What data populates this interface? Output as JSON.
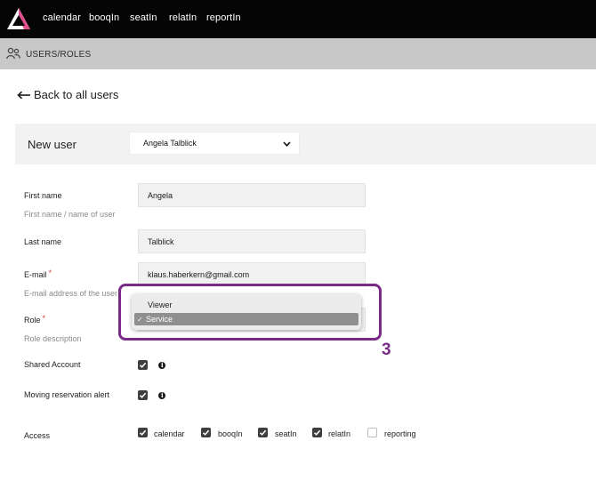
{
  "nav": {
    "items": [
      {
        "label": "calendar"
      },
      {
        "label": "booqIn"
      },
      {
        "label": "seatIn"
      },
      {
        "label": "relatIn"
      },
      {
        "label": "reportIn"
      }
    ]
  },
  "section": {
    "title": "USERS/ROLES"
  },
  "back": {
    "label": "Back to all users"
  },
  "header": {
    "title": "New user",
    "selected_user": "Angela Talblick"
  },
  "form": {
    "first_name": {
      "label": "First name",
      "value": "Angela",
      "help": "First name / name of user"
    },
    "last_name": {
      "label": "Last name",
      "value": "Talblick"
    },
    "email": {
      "label": "E-mail",
      "required_mark": "*",
      "value": "klaus.haberkern@gmail.com",
      "help": "E-mail address of the user"
    },
    "role": {
      "label": "Role",
      "required_mark": "*",
      "help": "Role description",
      "options": [
        {
          "label": "Viewer",
          "selected": false
        },
        {
          "label": "Service",
          "selected": true
        }
      ],
      "check_glyph": "✓"
    },
    "shared_account": {
      "label": "Shared Account",
      "checked": true,
      "info": "i"
    },
    "moving_alert": {
      "label": "Moving reservation alert",
      "checked": true,
      "info": "i"
    },
    "access": {
      "label": "Access",
      "items": [
        {
          "label": "calendar",
          "checked": true
        },
        {
          "label": "booqIn",
          "checked": true
        },
        {
          "label": "seatIn",
          "checked": true
        },
        {
          "label": "relatIn",
          "checked": true
        },
        {
          "label": "reporting",
          "checked": false
        }
      ]
    }
  },
  "annotation": {
    "step": "3",
    "color": "#7a2b88"
  },
  "colors": {
    "nav_bg": "#050505",
    "section_bg": "#c8c8c8",
    "brand_accent": "#e0508f"
  }
}
